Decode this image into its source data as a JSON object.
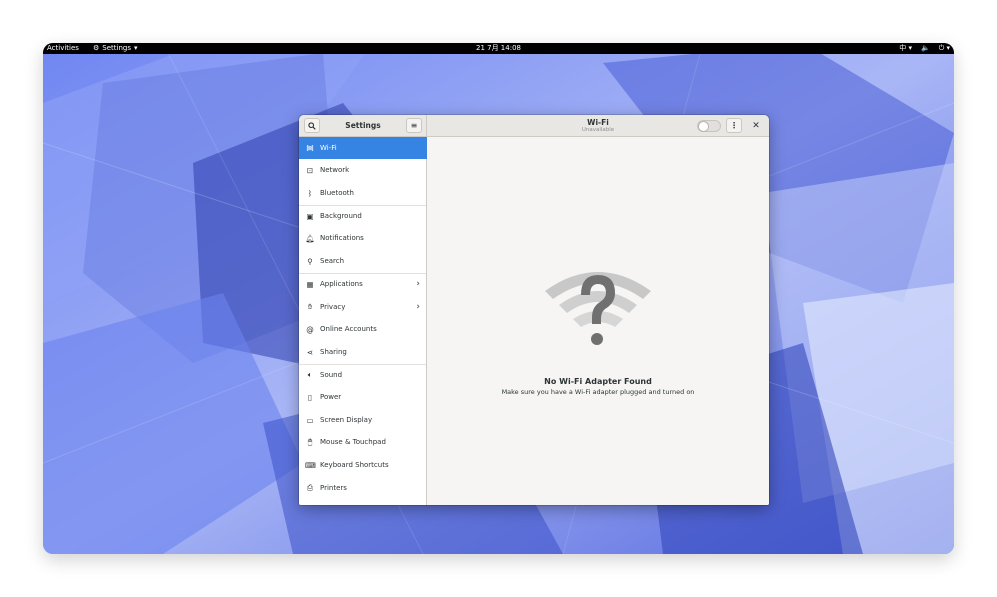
{
  "topbar": {
    "activities": "Activities",
    "app_menu": "Settings",
    "clock": "21 7月  14:08",
    "input_method": "中"
  },
  "window": {
    "sidebar_title": "Settings",
    "page_title": "Wi-Fi",
    "page_subtitle": "Unavailable",
    "wifi_switch_on": false
  },
  "sidebar": {
    "items": [
      {
        "label": "Wi-Fi",
        "icon": "wifi-icon"
      },
      {
        "label": "Network",
        "icon": "network-icon"
      },
      {
        "label": "Bluetooth",
        "icon": "bluetooth-icon"
      },
      {
        "label": "Background",
        "icon": "background-icon"
      },
      {
        "label": "Notifications",
        "icon": "bell-icon"
      },
      {
        "label": "Search",
        "icon": "search-icon"
      },
      {
        "label": "Applications",
        "icon": "applications-icon"
      },
      {
        "label": "Privacy",
        "icon": "hand-icon"
      },
      {
        "label": "Online Accounts",
        "icon": "at-icon"
      },
      {
        "label": "Sharing",
        "icon": "share-icon"
      },
      {
        "label": "Sound",
        "icon": "speaker-icon"
      },
      {
        "label": "Power",
        "icon": "battery-icon"
      },
      {
        "label": "Screen Display",
        "icon": "display-icon"
      },
      {
        "label": "Mouse & Touchpad",
        "icon": "mouse-icon"
      },
      {
        "label": "Keyboard Shortcuts",
        "icon": "keyboard-icon"
      },
      {
        "label": "Printers",
        "icon": "printer-icon"
      }
    ]
  },
  "content": {
    "empty_title": "No Wi-Fi Adapter Found",
    "empty_description": "Make sure you have a Wi-Fi adapter plugged and turned on"
  },
  "colors": {
    "accent": "#3584e4",
    "topbar": "#000000",
    "window_bg": "#f6f5f4"
  }
}
